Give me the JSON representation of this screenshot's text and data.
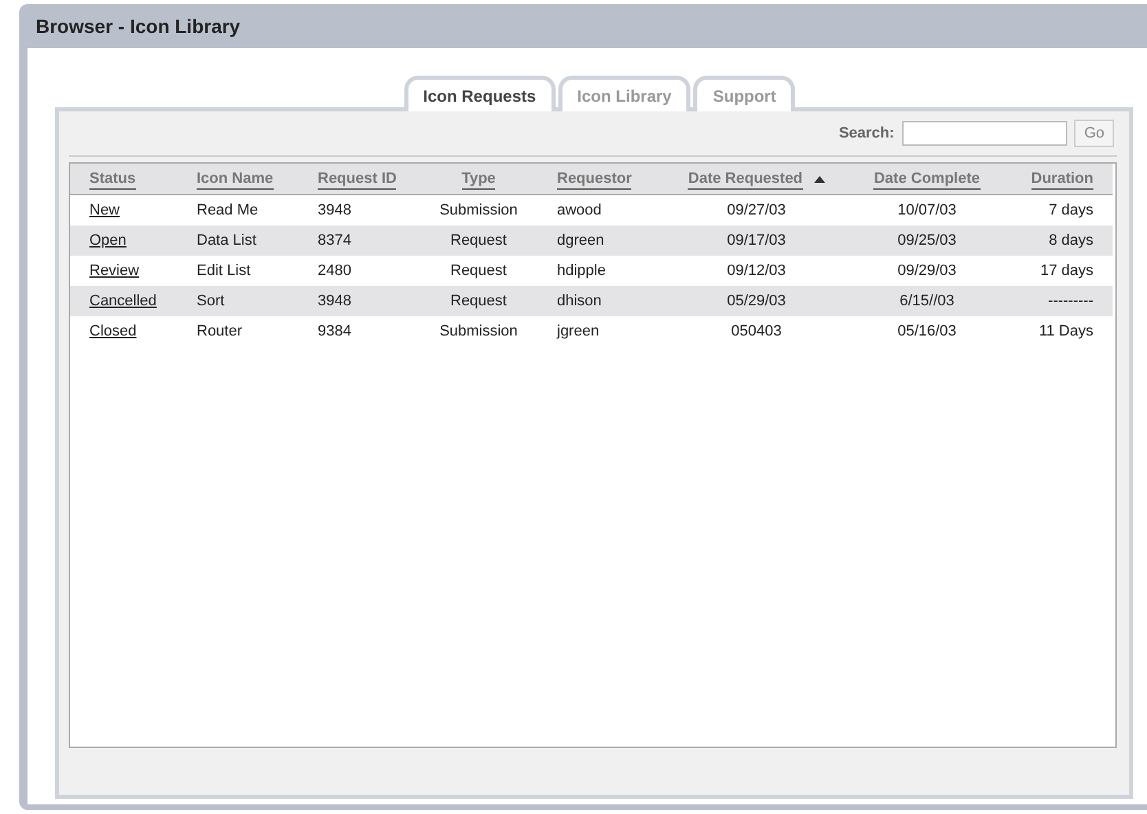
{
  "window": {
    "title": "Browser - Icon Library"
  },
  "tabs": [
    {
      "label": "Icon Requests",
      "selected": true
    },
    {
      "label": "Icon Library",
      "selected": false
    },
    {
      "label": "Support",
      "selected": false
    }
  ],
  "search": {
    "label": "Search:",
    "button": "Go"
  },
  "table": {
    "columns": [
      {
        "label": "Status",
        "sorted": false
      },
      {
        "label": "Icon Name",
        "sorted": false
      },
      {
        "label": "Request ID",
        "sorted": false
      },
      {
        "label": "Type",
        "sorted": false
      },
      {
        "label": "Requestor",
        "sorted": false
      },
      {
        "label": "Date Requested",
        "sorted": true
      },
      {
        "label": "Date Complete",
        "sorted": false
      },
      {
        "label": "Duration",
        "sorted": false
      }
    ],
    "rows": [
      [
        "New",
        "Read Me",
        "3948",
        "Submission",
        "awood",
        "09/27/03",
        "10/07/03",
        "7 days"
      ],
      [
        "Open",
        "Data List",
        "8374",
        "Request",
        "dgreen",
        "09/17/03",
        "09/25/03",
        "8 days"
      ],
      [
        "Review",
        "Edit List",
        "2480",
        "Request",
        "hdipple",
        "09/12/03",
        "09/29/03",
        "17 days"
      ],
      [
        "Cancelled",
        "Sort",
        "3948",
        "Request",
        "dhison",
        "05/29/03",
        "6/15//03",
        "---------"
      ],
      [
        "Closed",
        "Router",
        "9384",
        "Submission",
        "jgreen",
        "050403",
        "05/16/03",
        "11 Days"
      ]
    ]
  }
}
